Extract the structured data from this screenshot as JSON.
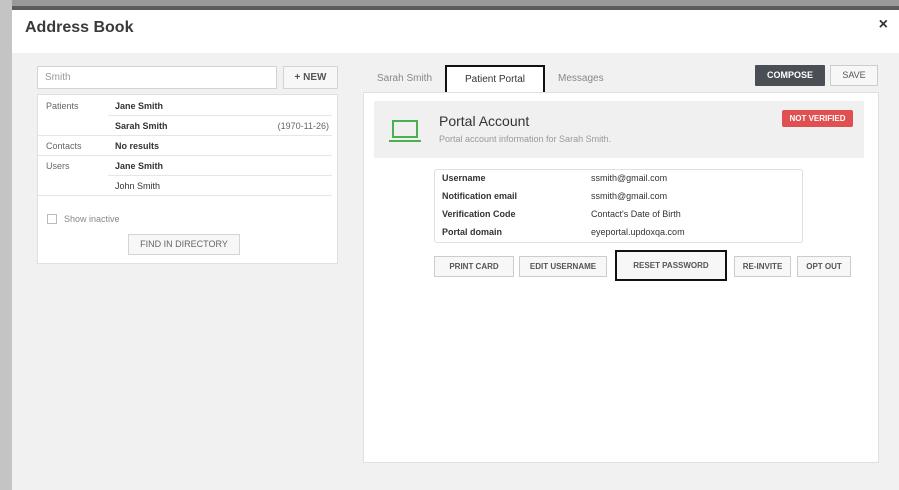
{
  "window": {
    "title": "Address Book",
    "close_symbol": "×"
  },
  "left": {
    "search": {
      "value": "Smith",
      "placeholder": ""
    },
    "new_button": "+ NEW",
    "categories": [
      {
        "label": "Patients",
        "entries": [
          {
            "name": "Jane Smith",
            "date": ""
          },
          {
            "name": "Sarah Smith",
            "date": "(1970-11-26)"
          }
        ]
      },
      {
        "label": "Contacts",
        "entries": [
          {
            "name": "No results",
            "date": ""
          }
        ]
      },
      {
        "label": "Users",
        "entries": [
          {
            "name": "Jane Smith",
            "date": ""
          },
          {
            "name": "John Smith",
            "date": ""
          }
        ]
      }
    ],
    "show_inactive": "Show inactive",
    "find_button": "FIND IN DIRECTORY"
  },
  "right": {
    "tabs": [
      "Sarah Smith",
      "Patient Portal",
      "Messages"
    ],
    "active_tab": "Patient Portal",
    "compose_button": "COMPOSE",
    "save_button": "SAVE",
    "portal": {
      "title": "Portal Account",
      "subtitle": "Portal account information for Sarah Smith.",
      "status_badge": "NOT VERIFIED",
      "status_color": "#e05050",
      "icon": "laptop-icon",
      "icon_color": "#4caf50",
      "fields": [
        {
          "label": "Username",
          "value": "ssmith@gmail.com"
        },
        {
          "label": "Notification email",
          "value": "ssmith@gmail.com"
        },
        {
          "label": "Verification Code",
          "value": "Contact's Date of Birth"
        },
        {
          "label": "Portal domain",
          "value": "eyeportal.updoxqa.com"
        }
      ],
      "actions": [
        "PRINT CARD",
        "EDIT USERNAME",
        "RESET PASSWORD",
        "RE-INVITE",
        "OPT OUT"
      ]
    }
  },
  "colors": {
    "compose_bg": "#4a4f55",
    "panel_bg": "#f1f1f1"
  }
}
